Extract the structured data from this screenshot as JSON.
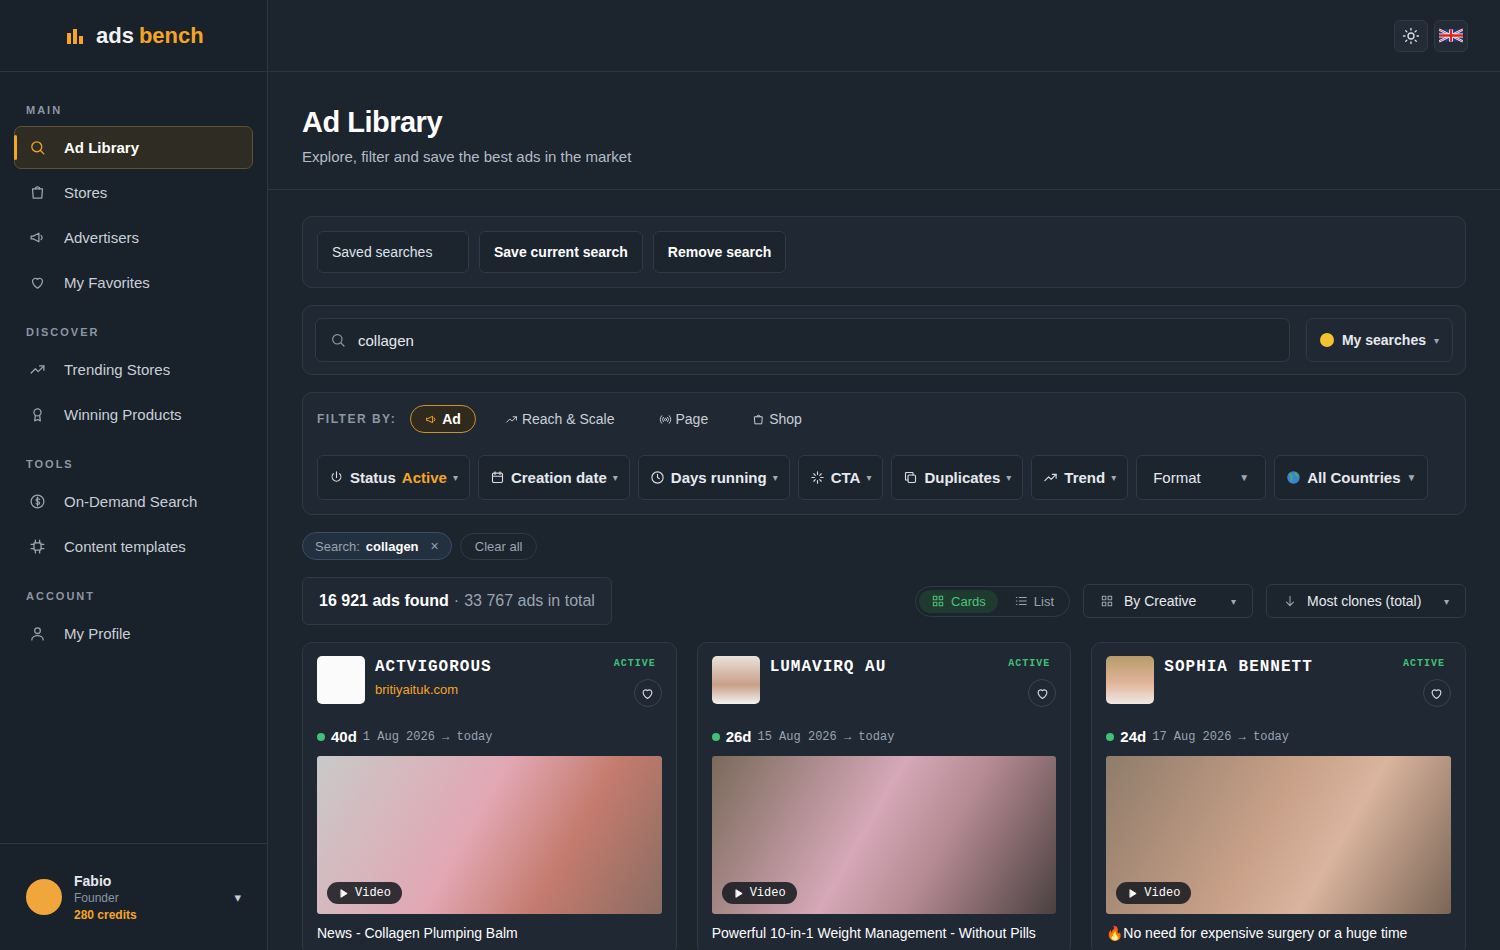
{
  "logo": {
    "first": "ads",
    "second": "bench"
  },
  "sidebar": {
    "sections": [
      {
        "title": "MAIN",
        "items": [
          {
            "label": "Ad Library",
            "selected": true
          },
          {
            "label": "Stores",
            "selected": false
          },
          {
            "label": "Advertisers",
            "selected": false
          },
          {
            "label": "My Favorites",
            "selected": false
          }
        ]
      },
      {
        "title": "DISCOVER",
        "items": [
          {
            "label": "Trending Stores",
            "selected": false
          },
          {
            "label": "Winning Products",
            "selected": false
          }
        ]
      },
      {
        "title": "TOOLS",
        "items": [
          {
            "label": "On-Demand Search",
            "selected": false
          },
          {
            "label": "Content templates",
            "selected": false
          }
        ]
      },
      {
        "title": "ACCOUNT",
        "items": [
          {
            "label": "My Profile",
            "selected": false
          }
        ]
      }
    ]
  },
  "user": {
    "name": "Fabio",
    "role": "Founder",
    "credits": "280 credits",
    "caret": "▾"
  },
  "page": {
    "title": "Ad Library",
    "subtitle": "Explore, filter and save the best ads in the market"
  },
  "saved_bar": {
    "buttons": [
      {
        "label": "Saved searches",
        "bold": false
      },
      {
        "label": "Save current search",
        "bold": true
      },
      {
        "label": "Remove search",
        "bold": true
      }
    ]
  },
  "search": {
    "value": "collagen",
    "my_searches": "My searches",
    "caret": "▾"
  },
  "filter_by": {
    "label": "FILTER BY:",
    "tabs": [
      {
        "label": "Ad",
        "selected": true
      },
      {
        "label": "Reach & Scale",
        "selected": false
      },
      {
        "label": "Page",
        "selected": false
      },
      {
        "label": "Shop",
        "selected": false
      }
    ]
  },
  "filters": [
    {
      "label": "Status",
      "value": "Active",
      "caret": "▾"
    },
    {
      "label": "Creation date",
      "caret": "▾"
    },
    {
      "label": "Days running",
      "caret": "▾"
    },
    {
      "label": "CTA",
      "caret": "▾"
    },
    {
      "label": "Duplicates",
      "caret": "▾"
    },
    {
      "label": "Trend",
      "caret": "▾"
    },
    {
      "label": "Format",
      "caret": "▼"
    },
    {
      "label": "All Countries",
      "caret": "▼"
    }
  ],
  "chips": [
    {
      "key": "Search:",
      "value": "collagen",
      "close": "×"
    }
  ],
  "clear_all": "Clear all",
  "results": {
    "found": "16 921 ads found",
    "separator": "·",
    "total": "33 767 ads in total"
  },
  "view_toggle": [
    {
      "label": "Cards",
      "selected": true
    },
    {
      "label": "List",
      "selected": false
    }
  ],
  "group_by": {
    "label": "By Creative",
    "caret": "▾"
  },
  "sort": {
    "label": "Most clones (total)",
    "caret": "▾"
  },
  "ads": [
    {
      "advertiser": "ACTVIGOROUS",
      "domain": "britiyaituk.com",
      "status": "ACTIVE",
      "running": true,
      "favorite": false,
      "days": "40d",
      "dates": "1 Aug 2026 → today",
      "media": "Video",
      "title": "News - Collagen Plumping Balm"
    },
    {
      "advertiser": "LUMAVIRQ AU",
      "domain": "",
      "status": "ACTIVE",
      "running": true,
      "favorite": false,
      "days": "26d",
      "dates": "15 Aug 2026 → today",
      "media": "Video",
      "title": "Powerful 10-in-1 Weight Management - Without Pills"
    },
    {
      "advertiser": "SOPHIA BENNETT",
      "domain": "",
      "status": "ACTIVE",
      "running": true,
      "favorite": false,
      "days": "24d",
      "dates": "17 Aug 2026 → today",
      "media": "Video",
      "title": "🔥No need for expensive surgery or a huge time"
    }
  ]
}
